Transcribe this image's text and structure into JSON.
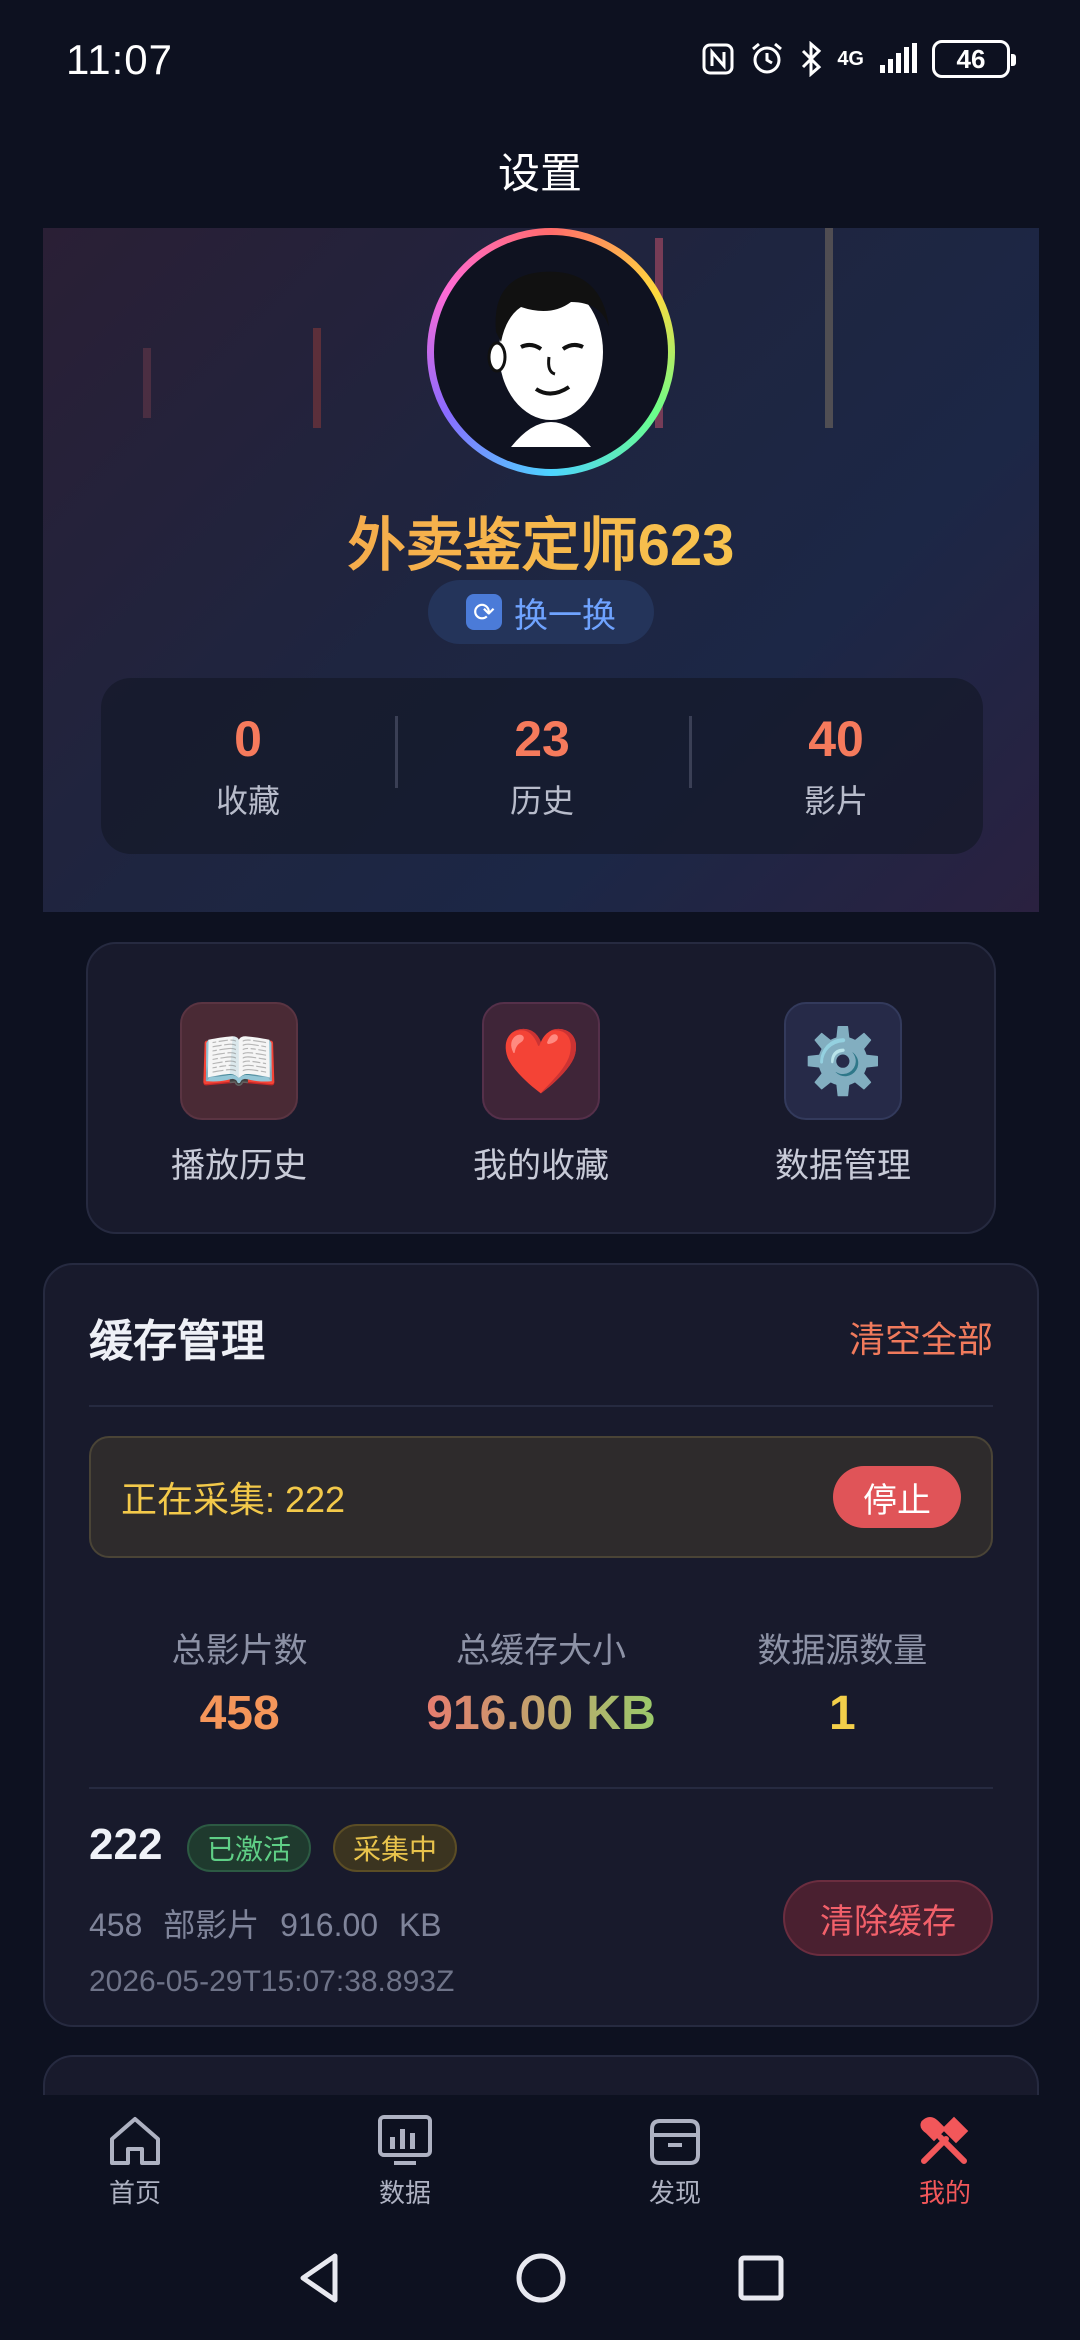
{
  "status_bar": {
    "time": "11:07",
    "network": "4G",
    "battery": "46"
  },
  "header": {
    "title": "设置"
  },
  "profile": {
    "username": "外卖鉴定师623",
    "swap_label": "换一换",
    "stats": [
      {
        "value": "0",
        "label": "收藏"
      },
      {
        "value": "23",
        "label": "历史"
      },
      {
        "value": "40",
        "label": "影片"
      }
    ]
  },
  "quick_actions": [
    {
      "label": "播放历史",
      "icon": "book-icon"
    },
    {
      "label": "我的收藏",
      "icon": "heart-icon"
    },
    {
      "label": "数据管理",
      "icon": "gear-icon"
    }
  ],
  "cache": {
    "title": "缓存管理",
    "clear_all_label": "清空全部",
    "collecting_text": "正在采集: 222",
    "stop_label": "停止",
    "summary": [
      {
        "label": "总影片数",
        "value": "458",
        "color": "#f5965a"
      },
      {
        "label": "总缓存大小",
        "value": "916.00 KB",
        "color": "#f07a6a"
      },
      {
        "label": "数据源数量",
        "value": "1",
        "color": "#f3cf4a"
      }
    ],
    "source": {
      "name": "222",
      "badge_active": "已激活",
      "badge_collecting": "采集中",
      "meta": "458 部影片 916.00 KB",
      "timestamp": "2026-05-29T15:07:38.893Z",
      "clear_label": "清除缓存"
    }
  },
  "bottom_nav": [
    {
      "label": "首页",
      "icon": "home-icon"
    },
    {
      "label": "数据",
      "icon": "chart-icon"
    },
    {
      "label": "发现",
      "icon": "folder-icon"
    },
    {
      "label": "我的",
      "icon": "tools-icon",
      "active": true
    }
  ],
  "colors": {
    "accent": "#f2575a",
    "background": "#0d1120",
    "card": "#181a2c"
  }
}
